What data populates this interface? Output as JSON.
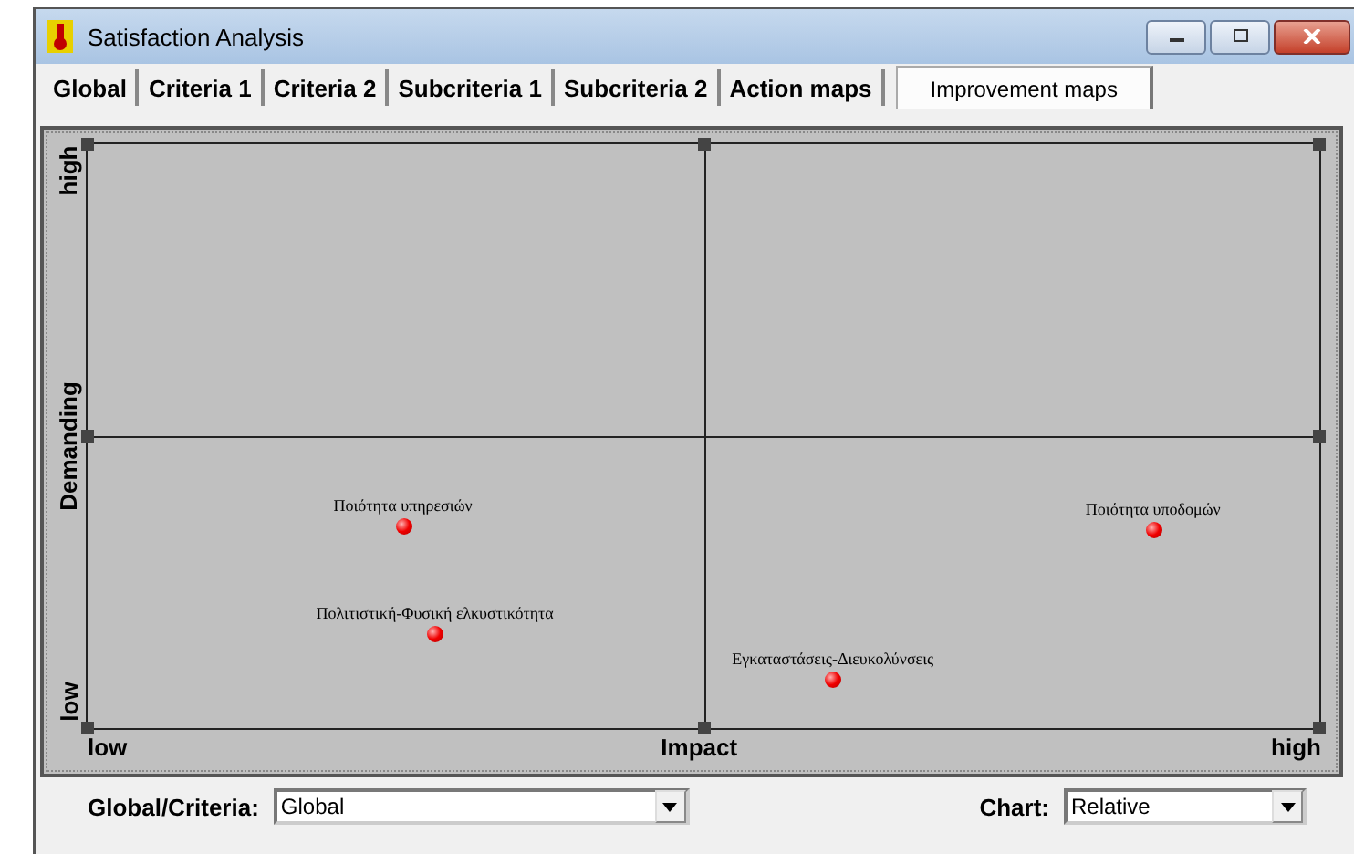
{
  "window": {
    "title": "Satisfaction Analysis"
  },
  "tabs": [
    {
      "label": "Global",
      "selected": false
    },
    {
      "label": "Criteria 1",
      "selected": false
    },
    {
      "label": "Criteria 2",
      "selected": false
    },
    {
      "label": "Subcriteria 1",
      "selected": false
    },
    {
      "label": "Subcriteria 2",
      "selected": false
    },
    {
      "label": "Action maps",
      "selected": false
    },
    {
      "label": "Improvement maps",
      "selected": true
    }
  ],
  "map": {
    "y_axis": {
      "high": "high",
      "title": "Demanding",
      "low": "low"
    },
    "x_axis": {
      "low": "low",
      "title": "Impact",
      "high": "high"
    },
    "points": [
      {
        "label": "Ποιότητα υπηρεσιών"
      },
      {
        "label": "Πολιτιστική-Φυσική ελκυστικότητα"
      },
      {
        "label": "Εγκαταστάσεις-Διευκολύνσεις"
      },
      {
        "label": "Ποιότητα υποδομών"
      }
    ]
  },
  "controls": [
    {
      "label": "Global/Criteria:",
      "value": "Global"
    },
    {
      "label": "Chart:",
      "value": "Relative"
    }
  ]
}
